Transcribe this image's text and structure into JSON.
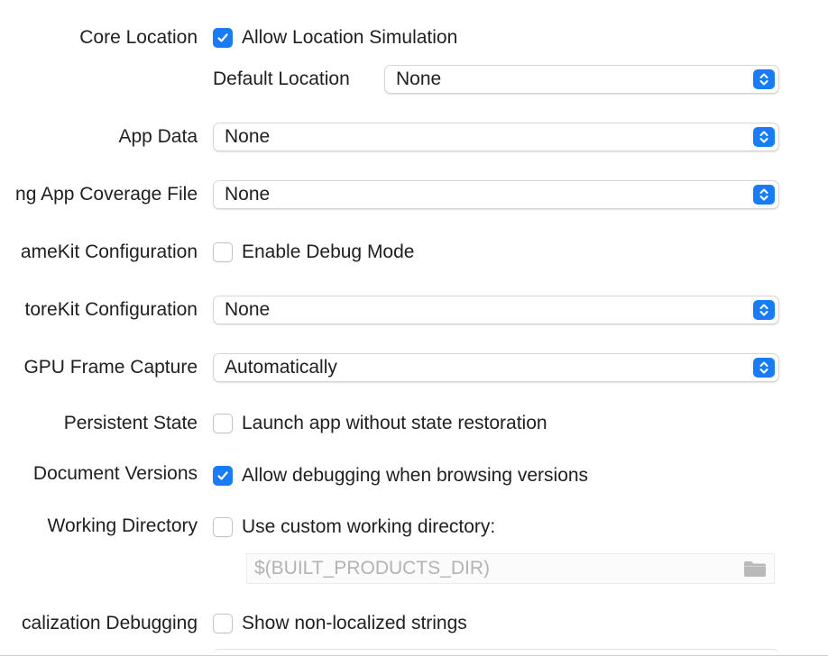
{
  "rows": {
    "core_location": {
      "label": "Core Location",
      "checkbox_label": "Allow Location Simulation",
      "checked": true
    },
    "default_location": {
      "label": "Default Location",
      "value": "None"
    },
    "app_data": {
      "label": "App Data",
      "value": "None"
    },
    "app_coverage": {
      "label": "ng App Coverage File",
      "value": "None"
    },
    "gamekit": {
      "label": "ameKit Configuration",
      "checkbox_label": "Enable Debug Mode",
      "checked": false
    },
    "storekit": {
      "label": "toreKit Configuration",
      "value": "None"
    },
    "gpu_frame_capture": {
      "label": "GPU Frame Capture",
      "value": "Automatically"
    },
    "persistent_state": {
      "label": "Persistent State",
      "checkbox_label": "Launch app without state restoration",
      "checked": false
    },
    "document_versions": {
      "label": "Document Versions",
      "checkbox_label": "Allow debugging when browsing versions",
      "checked": true
    },
    "working_directory": {
      "label": "Working Directory",
      "checkbox_label": "Use custom working directory:",
      "checked": false,
      "path_placeholder": "$(BUILT_PRODUCTS_DIR)"
    },
    "localization_debugging": {
      "label": "calization Debugging",
      "checkbox_label": "Show non-localized strings",
      "checked": false
    }
  },
  "icons": {
    "stepper": "chevron-up-down-icon",
    "check": "checkmark-icon",
    "folder": "folder-icon"
  },
  "colors": {
    "accent": "#1a7cf5",
    "placeholder": "#b3b3b3"
  }
}
